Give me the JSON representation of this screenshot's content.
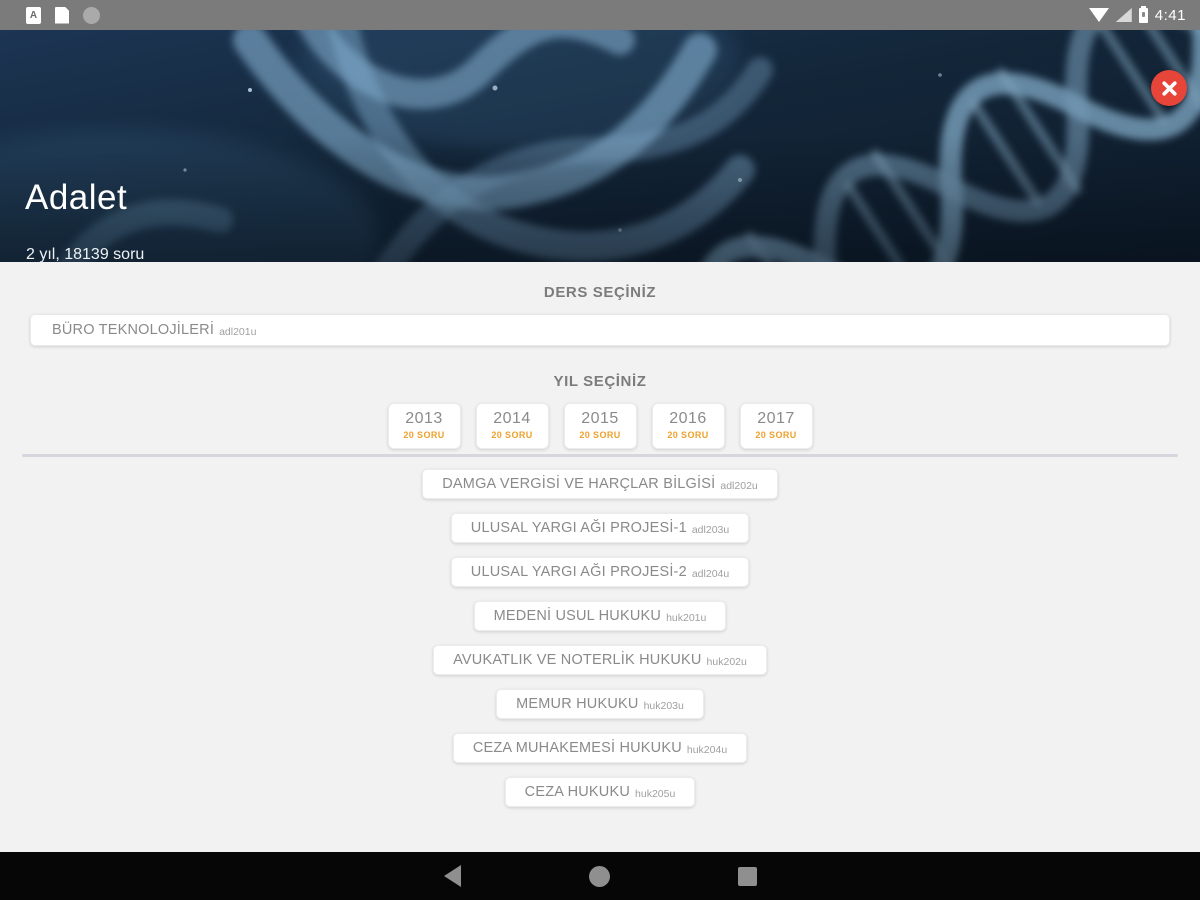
{
  "status_bar": {
    "time": "4:41"
  },
  "header": {
    "title": "Adalet",
    "subtitle": "2 yıl, 18139 soru"
  },
  "course_select": {
    "label": "DERS SEÇİNİZ",
    "selected": {
      "name": "BÜRO TEKNOLOJİLERİ",
      "code": "adl201u"
    }
  },
  "year_select": {
    "label": "YIL SEÇİNİZ",
    "items": [
      {
        "year": "2013",
        "soru": "20 SORU"
      },
      {
        "year": "2014",
        "soru": "20 SORU"
      },
      {
        "year": "2015",
        "soru": "20 SORU"
      },
      {
        "year": "2016",
        "soru": "20 SORU"
      },
      {
        "year": "2017",
        "soru": "20 SORU"
      }
    ]
  },
  "course_list": {
    "items": [
      {
        "name": "DAMGA VERGİSİ VE HARÇLAR BİLGİSİ",
        "code": "adl202u"
      },
      {
        "name": "ULUSAL YARGI AĞI PROJESİ-1",
        "code": "adl203u"
      },
      {
        "name": "ULUSAL YARGI AĞI PROJESİ-2",
        "code": "adl204u"
      },
      {
        "name": "MEDENİ USUL HUKUKU",
        "code": "huk201u"
      },
      {
        "name": "AVUKATLIK VE NOTERLİK HUKUKU",
        "code": "huk202u"
      },
      {
        "name": "MEMUR HUKUKU",
        "code": "huk203u"
      },
      {
        "name": "CEZA MUHAKEMESİ HUKUKU",
        "code": "huk204u"
      },
      {
        "name": "CEZA HUKUKU",
        "code": "huk205u"
      }
    ]
  },
  "icons": {
    "close": "x-cross",
    "nav_back": "left-triangle",
    "nav_home": "circle",
    "nav_recents": "square"
  },
  "colors": {
    "accent_orange": "#EFA12C",
    "close_red": "#E8453A",
    "header_navy": "#132639",
    "status_gray": "#7B7B7B",
    "divider": "#D6D6DE",
    "main_bg": "#F3F2F2"
  }
}
